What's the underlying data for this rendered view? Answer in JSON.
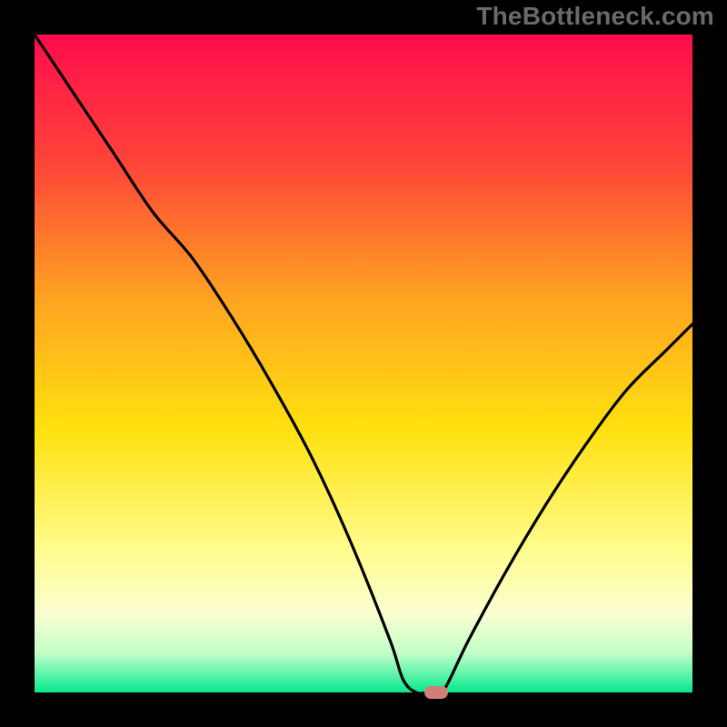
{
  "watermark": "TheBottleneck.com",
  "chart_data": {
    "type": "line",
    "title": "",
    "xlabel": "",
    "ylabel": "",
    "xlim": [
      0,
      100
    ],
    "ylim": [
      0,
      100
    ],
    "grid": false,
    "gradient_background": true,
    "gradient_stops": [
      {
        "offset": 0.0,
        "color": "#ff0c4c"
      },
      {
        "offset": 0.2,
        "color": "#ff4638"
      },
      {
        "offset": 0.4,
        "color": "#ffa321"
      },
      {
        "offset": 0.6,
        "color": "#ffe10e"
      },
      {
        "offset": 0.78,
        "color": "#fffc8b"
      },
      {
        "offset": 0.88,
        "color": "#fbffd0"
      },
      {
        "offset": 0.94,
        "color": "#c3ffc8"
      },
      {
        "offset": 0.975,
        "color": "#57f3a9"
      },
      {
        "offset": 1.0,
        "color": "#06e78c"
      }
    ],
    "series": [
      {
        "name": "bottleneck-curve",
        "x": [
          0,
          6,
          12,
          18,
          24,
          30,
          36,
          42,
          48,
          54,
          56,
          58,
          60,
          62,
          66,
          72,
          78,
          84,
          90,
          96,
          100
        ],
        "y": [
          100,
          91,
          82,
          73,
          66,
          57,
          47,
          36,
          23,
          8,
          2,
          0,
          0,
          0,
          8,
          19,
          29,
          38,
          46,
          52,
          56
        ]
      }
    ],
    "marker": {
      "x": 61,
      "y": 0,
      "color": "#d17d79"
    }
  }
}
